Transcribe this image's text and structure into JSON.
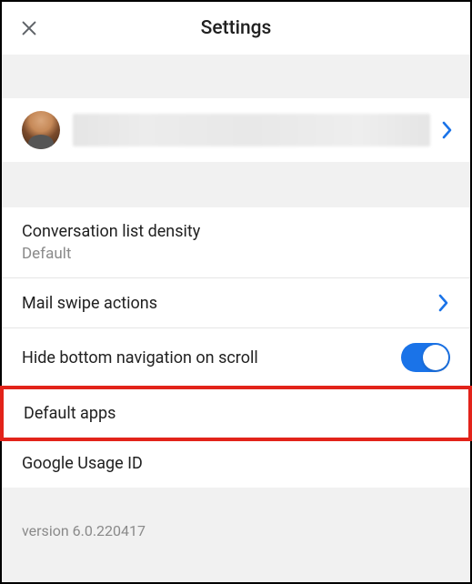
{
  "header": {
    "title": "Settings"
  },
  "account": {
    "name_redacted": true
  },
  "settings": {
    "density": {
      "label": "Conversation list density",
      "value": "Default"
    },
    "swipe": {
      "label": "Mail swipe actions"
    },
    "hide_nav": {
      "label": "Hide bottom navigation on scroll",
      "enabled": true
    },
    "default_apps": {
      "label": "Default apps"
    },
    "usage_id": {
      "label": "Google Usage ID"
    }
  },
  "footer": {
    "version": "version 6.0.220417"
  },
  "colors": {
    "accent": "#1a73e8",
    "highlight": "#e2231a"
  }
}
